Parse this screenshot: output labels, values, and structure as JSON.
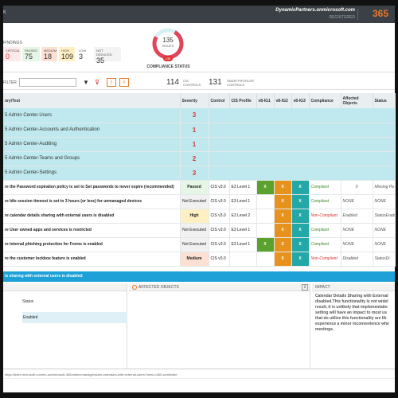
{
  "topbar": {
    "logo_fragment": "K",
    "domain": "DynamicPartners.onmicrosoft.com",
    "role": "REGISTERED",
    "product": "365"
  },
  "summary": {
    "findings_label": "FINDINGS",
    "cards": [
      {
        "label": "CRITICAL",
        "value": "0"
      },
      {
        "label": "PASSED",
        "value": "75"
      },
      {
        "label": "MEDIUM",
        "value": "18"
      },
      {
        "label": "HIGH",
        "value": "109"
      },
      {
        "label": "LOW",
        "value": "3"
      },
      {
        "label": "NOT DEDUCED",
        "value": "35"
      }
    ],
    "donut": {
      "value": "135",
      "label": "ISSUES",
      "badge": "135"
    },
    "compliance_status": "COMPLIANCE STATUS"
  },
  "filterbar": {
    "filter_label": "FILTER",
    "cis_controls_count": "114",
    "cis_controls_label": "CIS CONTROLS",
    "smartprofiler_count": "131",
    "smartprofiler_label": "SMARTPROFILER CONTROLS"
  },
  "grid": {
    "headers": [
      "ory\\Test",
      "Severity",
      "Control",
      "CIS Profile",
      "v8-IG1",
      "v8-IG2",
      "v8-IG3",
      "Compliance",
      "Affected Objects",
      "Status"
    ],
    "groups": [
      {
        "title": "5 Admin Center-Users",
        "count": "3"
      },
      {
        "title": "5 Admin Center-Accounts and Authentication",
        "count": "1"
      },
      {
        "title": "5 Admin Center-Auditing",
        "count": "1"
      },
      {
        "title": "5 Admin Center-Teams and Groups",
        "count": "2"
      },
      {
        "title": "5 Admin Center-Settings",
        "count": "3"
      }
    ],
    "items": [
      {
        "title": "re the Password expiration policy is set to Set passwords to never expire (recommended)",
        "severity": "Passed",
        "control": "CIS v3.0",
        "profile": "E3 Level 1",
        "ig1": "X",
        "ig2": "X",
        "ig3": "X",
        "compliance": "Compliant",
        "affected": "0",
        "status": "Missing Pa"
      },
      {
        "title": "re Idle session timeout is set to 3 hours (or less) for unmanaged devices",
        "severity": "Not Executed",
        "control": "CIS v3.0",
        "profile": "E3 Level 1",
        "ig1": "",
        "ig2": "X",
        "ig3": "X",
        "compliance": "Compliant",
        "affected": "NONE",
        "status": "NONE"
      },
      {
        "title": "re calendar details sharing with external users is disabled",
        "severity": "High",
        "control": "CIS v3.0",
        "profile": "E3 Level 2",
        "ig1": "",
        "ig2": "X",
        "ig3": "X",
        "compliance": "Non-Compliant",
        "affected": "Enabled",
        "status": "StatusEnabl"
      },
      {
        "title": "re User owned apps and services is restricted",
        "severity": "Not Executed",
        "control": "CIS v3.0",
        "profile": "E3 Level 1",
        "ig1": "",
        "ig2": "X",
        "ig3": "X",
        "compliance": "Compliant",
        "affected": "NONE",
        "status": "NONE"
      },
      {
        "title": "re internal phishing protection for Forms is enabled",
        "severity": "Not Executed",
        "control": "CIS v3.0",
        "profile": "E3 Level 1",
        "ig1": "X",
        "ig2": "X",
        "ig3": "X",
        "compliance": "Compliant",
        "affected": "NONE",
        "status": "NONE"
      },
      {
        "title": "re the customer lockbox feature is enabled",
        "severity": "Medium",
        "control": "CIS v3.0",
        "profile": "",
        "ig1": "",
        "ig2": "X",
        "ig3": "X",
        "compliance": "Non-Compliant",
        "affected": "Disabled",
        "status": "StatusDi"
      }
    ]
  },
  "detail": {
    "title": "ls sharing with external users is disabled",
    "affected_objects_label": "AFFECTED OBJECTS",
    "impact_label": "IMPACT",
    "status_key": "Status",
    "status_value": "Enabled",
    "impact_text": "Calendar Details Sharing with External disabled.This functionality is not widel result, it is unlikely that implementatio setting will have an impact to most us that do utilize this functionality are lik experience a minor inconvenience whe meetings."
  },
  "url": "https://learn.microsoft.com/en-us/microsoft-365/admin/manage/share-calendars-with-external-users?view=o365-worldwide"
}
